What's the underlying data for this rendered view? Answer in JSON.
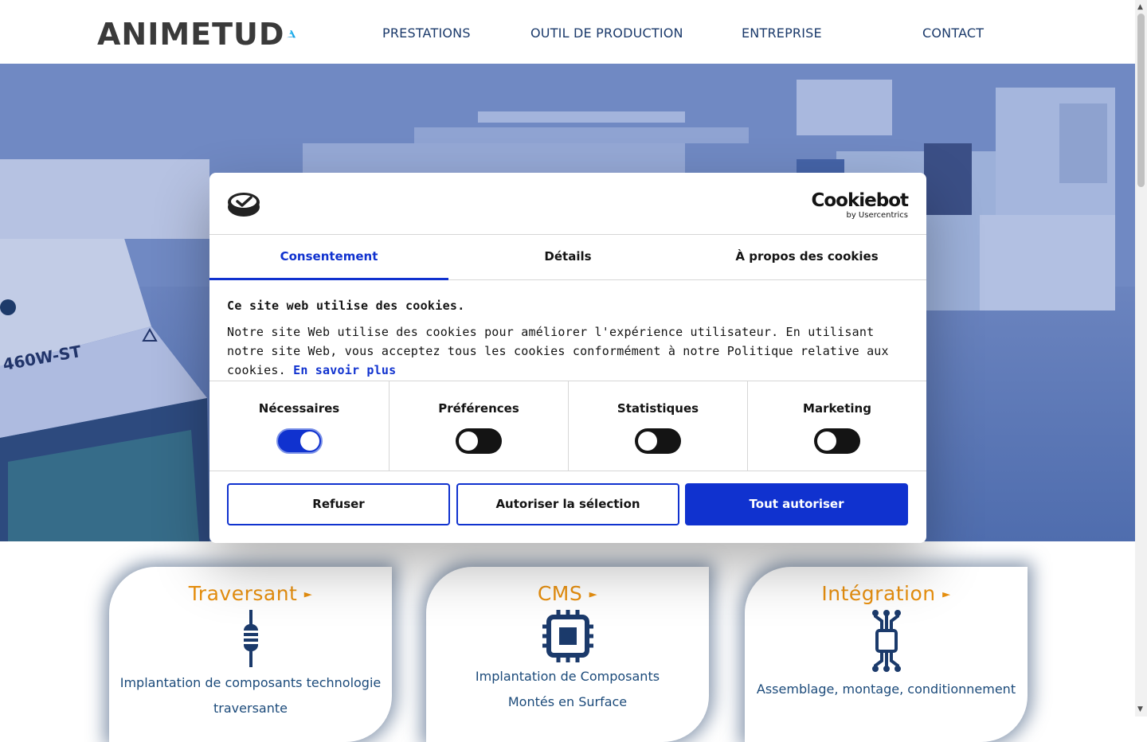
{
  "header": {
    "logo_text": "ANIMETUD",
    "nav": [
      "PRESTATIONS",
      "OUTIL DE PRODUCTION",
      "ENTREPRISE",
      "CONTACT"
    ]
  },
  "hero": {
    "machine_label": "460W-ST"
  },
  "cookie_dialog": {
    "brand": "Cookiebot",
    "brand_sub": "by Usercentrics",
    "tabs": [
      "Consentement",
      "Détails",
      "À propos des cookies"
    ],
    "active_tab": "Consentement",
    "heading": "Ce site web utilise des cookies.",
    "body": "Notre site Web utilise des cookies pour améliorer l'expérience utilisateur. En utilisant notre site Web, vous acceptez tous les cookies conformément à notre Politique relative aux cookies.",
    "learn_more": "En savoir plus",
    "toggles": [
      {
        "label": "Nécessaires",
        "on": true
      },
      {
        "label": "Préférences",
        "on": false
      },
      {
        "label": "Statistiques",
        "on": false
      },
      {
        "label": "Marketing",
        "on": false
      }
    ],
    "buttons": {
      "refuse": "Refuser",
      "allow_selection": "Autoriser la sélection",
      "allow_all": "Tout autoriser"
    }
  },
  "cards": [
    {
      "title": "Traversant",
      "arrow": "►",
      "icon": "resistor-icon",
      "desc_lines": [
        "Implantation de composants technologie",
        "traversante"
      ]
    },
    {
      "title": "CMS",
      "arrow": "►",
      "icon": "chip-icon",
      "desc_lines": [
        "Implantation de Composants",
        "Montés en Surface"
      ]
    },
    {
      "title": "Intégration",
      "arrow": "►",
      "icon": "circuit-icon",
      "desc_lines": [
        "Assemblage, montage, conditionnement"
      ]
    }
  ],
  "colors": {
    "accent": "#1032cf",
    "card_title": "#e8900f",
    "nav_text": "#1b3a6b"
  }
}
